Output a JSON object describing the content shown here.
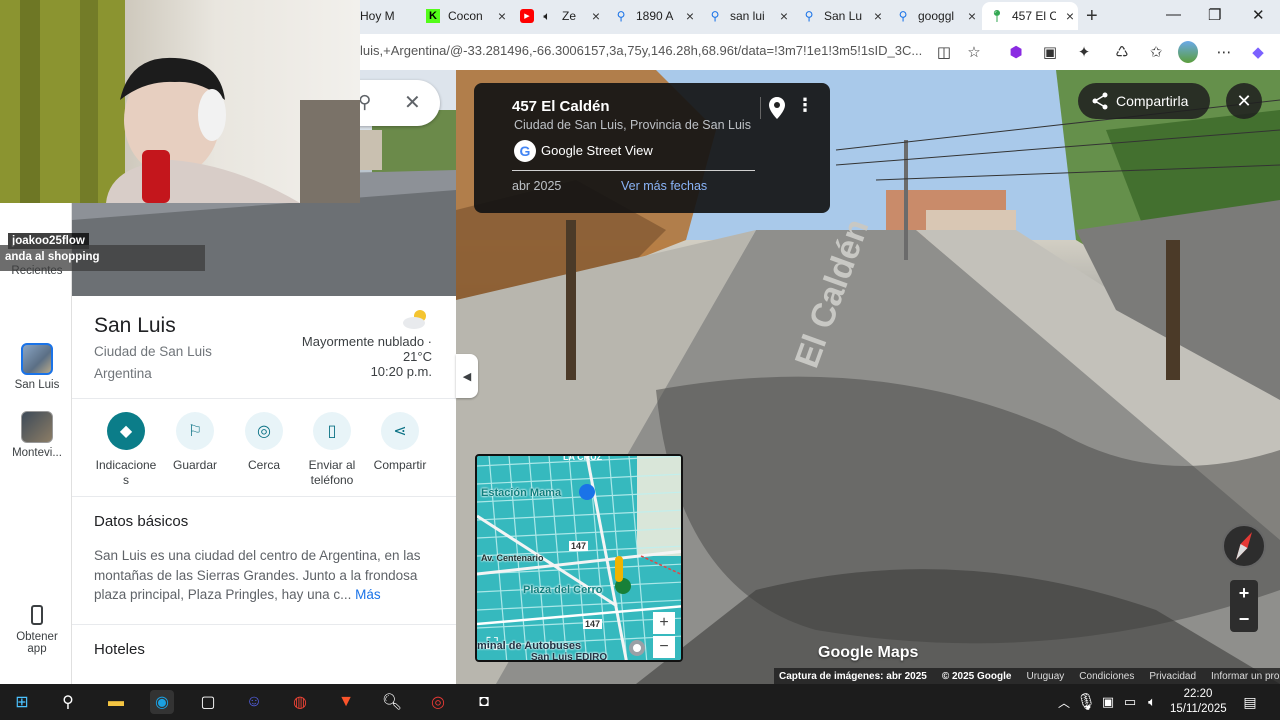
{
  "browser": {
    "tabs": [
      {
        "label": "Hoy M",
        "icon": "youtube-icon"
      },
      {
        "label": "Cocon",
        "icon": "kick-icon"
      },
      {
        "label": "Ze",
        "icon": "youtube-icon"
      },
      {
        "label": "1890 A",
        "icon": "search-icon"
      },
      {
        "label": "san lui",
        "icon": "search-icon"
      },
      {
        "label": "San Lu",
        "icon": "search-icon"
      },
      {
        "label": "googgl",
        "icon": "search-icon"
      },
      {
        "label": "457 El C",
        "icon": "maps-pin-icon"
      }
    ],
    "url": "luis,+Argentina/@-33.281496,-66.3006157,3a,75y,146.28h,68.96t/data=!3m7!1e1!3m5!1sID_3C..."
  },
  "stream_overlay": {
    "chat_user": "joakoo25flow",
    "chat_message": "anda al shopping"
  },
  "left_rail": {
    "recents_label": "Recientes",
    "items": [
      {
        "label": "San Luis"
      },
      {
        "label": "Montevi..."
      }
    ],
    "get_app_label": "Obtener app"
  },
  "place": {
    "title": "San Luis",
    "subtitle1": "Ciudad de San Luis",
    "subtitle2": "Argentina",
    "weather_desc": "Mayormente nublado ·",
    "weather_temp": "21°C",
    "weather_time": "10:20 p.m.",
    "actions": [
      {
        "label": "Indicaciones",
        "icon": "directions-icon"
      },
      {
        "label": "Guardar",
        "icon": "bookmark-icon"
      },
      {
        "label": "Cerca",
        "icon": "nearby-icon"
      },
      {
        "label": "Enviar al teléfono",
        "icon": "send-to-phone-icon"
      },
      {
        "label": "Compartir",
        "icon": "share-icon"
      }
    ],
    "basics_title": "Datos básicos",
    "basics_text": "San Luis es una ciudad del centro de Argentina, en las montañas de las Sierras Grandes. Junto a la frondosa plaza principal, Plaza Pringles, hay una c...",
    "more_link": "Más",
    "hotels_title": "Hoteles"
  },
  "streetview": {
    "address": "457 El Caldén",
    "locality": "Ciudad de San Luis, Provincia de San Luis",
    "source": "Google Street View",
    "date": "abr 2025",
    "more_dates": "Ver más fechas",
    "share_label": "Compartirla",
    "street_sign": "El Caldén",
    "logo": "Google Maps",
    "footer": {
      "capture": "Captura de imágenes: abr 2025",
      "copyright": "© 2025 Google",
      "country": "Uruguay",
      "terms": "Condiciones",
      "privacy": "Privacidad",
      "report": "Informar un problema"
    }
  },
  "minimap": {
    "labels": {
      "top": "LA CRUZ",
      "station": "Estación Mama",
      "avenue": "Av. Centenario",
      "route1": "147",
      "plaza": "Plaza del Cerro",
      "route2": "147",
      "terminal": "minal de Autobuses",
      "terminal2": "San Luis EDIRO"
    }
  },
  "taskbar": {
    "time": "22:20",
    "date": "15/11/2025"
  },
  "colors": {
    "accent": "#0b7d89",
    "link": "#1a73e8",
    "map_water": "#42c3c8"
  }
}
